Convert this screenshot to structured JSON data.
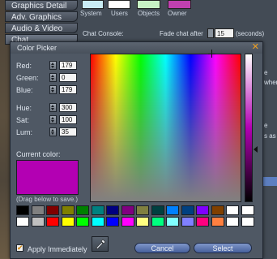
{
  "preferences": {
    "tabs": [
      {
        "label": "Graphics Detail",
        "active": false
      },
      {
        "label": "Adv. Graphics",
        "active": false
      },
      {
        "label": "Audio & Video",
        "active": false
      },
      {
        "label": "Chat",
        "active": true
      }
    ],
    "color_swatches": [
      {
        "label": "System",
        "color": "#c9ecf4"
      },
      {
        "label": "Users",
        "color": "#ffffff"
      },
      {
        "label": "Objects",
        "color": "#c7f2c4"
      },
      {
        "label": "Owner",
        "color": "#c040b0"
      }
    ],
    "chat_console_label": "Chat Console:",
    "fade_chat_label": "Fade chat after",
    "fade_chat_value": "15",
    "seconds_label": "(seconds)",
    "peek": [
      "e",
      "when",
      "e",
      "s as"
    ]
  },
  "color_picker": {
    "title": "Color Picker",
    "close_icon": "close-x-icon",
    "fields": [
      {
        "key": "red",
        "label": "Red:",
        "value": "179"
      },
      {
        "key": "green",
        "label": "Green:",
        "value": "0"
      },
      {
        "key": "blue",
        "label": "Blue:",
        "value": "179"
      },
      {
        "key": "hue",
        "label": "Hue:",
        "value": "300"
      },
      {
        "key": "sat",
        "label": "Sat:",
        "value": "100"
      },
      {
        "key": "lum",
        "label": "Lum:",
        "value": "35"
      }
    ],
    "current_color_label": "Current color:",
    "current_color": "#b300b3",
    "drag_hint": "(Drag below to save.)",
    "swatch_rows": [
      [
        "#000000",
        "#808080",
        "#800000",
        "#808000",
        "#008000",
        "#008080",
        "#000080",
        "#800080",
        "#808040",
        "#004040",
        "#0080ff",
        "#004080",
        "#8000ff",
        "#804000",
        "#ffffff",
        "#ffffff"
      ],
      [
        "#ffffff",
        "#c0c0c0",
        "#ff0000",
        "#ffff00",
        "#00ff00",
        "#00ffff",
        "#0000ff",
        "#ff00ff",
        "#ffff80",
        "#00ff80",
        "#80ffff",
        "#8080ff",
        "#ff0080",
        "#ff8040",
        "#ffffff",
        "#ffffff"
      ]
    ],
    "apply_immediately_label": "Apply Immediately",
    "apply_immediately_checked": true,
    "eyedropper_icon": "eyedropper-icon",
    "cancel_label": "Cancel",
    "select_label": "Select"
  }
}
